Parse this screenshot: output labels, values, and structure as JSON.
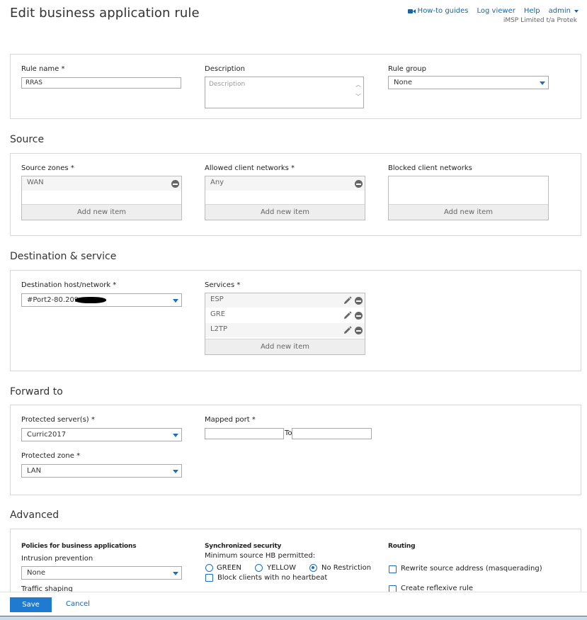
{
  "header": {
    "title": "Edit business application rule",
    "nav": {
      "how_to": "How-to guides",
      "log_viewer": "Log viewer",
      "help": "Help",
      "user": "admin"
    },
    "org": "iMSP Limited t/a Protek"
  },
  "general": {
    "rule_name_label": "Rule name *",
    "rule_name_value": "RRAS",
    "description_label": "Description",
    "description_placeholder": "Description",
    "rule_group_label": "Rule group",
    "rule_group_value": "None"
  },
  "source": {
    "title": "Source",
    "zones_label": "Source zones *",
    "zones": [
      "WAN"
    ],
    "allowed_label": "Allowed client networks *",
    "allowed": [
      "Any"
    ],
    "blocked_label": "Blocked client networks",
    "add_new": "Add new item"
  },
  "destination": {
    "title": "Destination & service",
    "host_label": "Destination host/network *",
    "host_value": "#Port2-80.209",
    "services_label": "Services *",
    "services": [
      "ESP",
      "GRE",
      "L2TP"
    ],
    "add_new": "Add new item"
  },
  "forward": {
    "title": "Forward to",
    "server_label": "Protected server(s) *",
    "server_value": "Curric2017",
    "zone_label": "Protected zone *",
    "zone_value": "LAN",
    "port_label": "Mapped port *",
    "port_from": "",
    "to_label": "To",
    "port_to": ""
  },
  "advanced": {
    "title": "Advanced",
    "policies_heading": "Policies for business applications",
    "ips_label": "Intrusion prevention",
    "ips_value": "None",
    "traffic_label": "Traffic shaping",
    "sync_heading": "Synchronized security",
    "hb_label": "Minimum source HB permitted:",
    "hb_options": [
      "GREEN",
      "YELLOW",
      "No Restriction"
    ],
    "hb_selected": "No Restriction",
    "block_label": "Block clients with no heartbeat",
    "block_checked": false,
    "routing_heading": "Routing",
    "rewrite_label": "Rewrite source address (masquerading)",
    "rewrite_checked": false,
    "reflexive_label": "Create reflexive rule",
    "reflexive_checked": false
  },
  "footer": {
    "save": "Save",
    "cancel": "Cancel"
  },
  "colors": {
    "accent": "#1e7bd0",
    "link": "#1565a8",
    "panel_border": "#d8d8d8"
  }
}
